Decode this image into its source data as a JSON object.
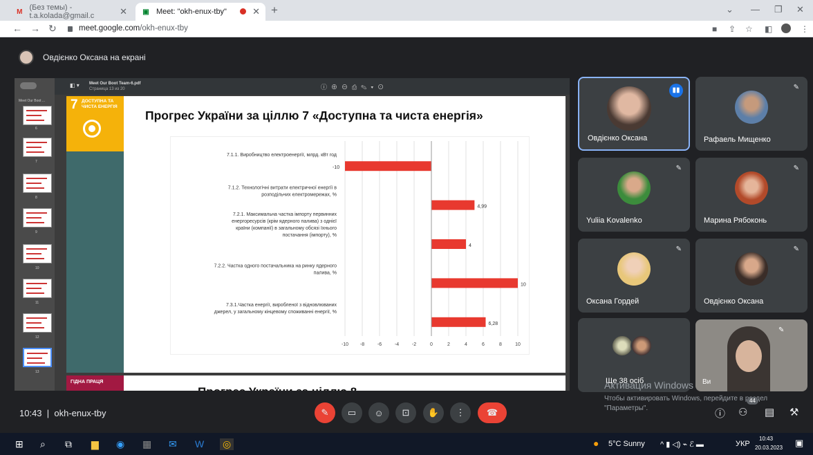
{
  "browser": {
    "tab1_title": "(Без темы) - t.a.kolada@gmail.c",
    "tab2_title": "Meet: \"okh-enux-tby\"",
    "url_host": "meet.google.com",
    "url_path": "/okh-enux-tby"
  },
  "meet": {
    "presenter_label": "Овдієнко Оксана на екрані",
    "meeting_time": "10:43",
    "meeting_code": "okh-enux-tby",
    "participants_count": "44"
  },
  "pdf": {
    "file_name": "Meet Our Boot Team-6.pdf",
    "page_label": "Страница 13 из 20",
    "thumb_header": "Meet Our Boot ...",
    "thumb_pages": [
      "6",
      "7",
      "8",
      "9",
      "10",
      "11",
      "12",
      "13"
    ]
  },
  "slide": {
    "sdg_number": "7",
    "sdg_label": "ДОСТУПНА ТА ЧИСТА ЕНЕРГІЯ",
    "title": "Прогрес України за ціллю 7 «Доступна та чиста енергія»",
    "next_sdg_label": "ГІДНА ПРАЦЯ",
    "next_title": "Прогрес України за ціллю 8"
  },
  "chart_data": {
    "type": "bar",
    "orientation": "horizontal",
    "categories": [
      "7.1.1. Виробництво електроенергії, млрд. кВт год",
      "7.1.2. Технологічні витрати електричної енергії в розподільчих електромережах, %",
      "7.2.1. Максимальна частка імпорту первинних енергоресурсів (крім ядерного палива) з однієї країни (компанії) в загальному обсязі їхнього постачання (імпорту), %",
      "7.2.2. Частка одного постачальника на ринку ядерного палива, %",
      "7.3.1.Частка енергії, виробленої з відновлюваних джерел, у загальному кінцевому споживанні енергії, %"
    ],
    "values": [
      -10,
      4.99,
      4,
      10,
      6.28
    ],
    "data_labels": [
      "-10",
      "4,99",
      "4",
      "10",
      "6,28"
    ],
    "xlim": [
      -10,
      10
    ],
    "x_ticks": [
      "-10",
      "-8",
      "-6",
      "-4",
      "-2",
      "0",
      "2",
      "4",
      "6",
      "8",
      "10"
    ],
    "bar_color": "#e8392f",
    "grid": true
  },
  "participants": [
    {
      "name": "Овдієнко Оксана",
      "speaking": true
    },
    {
      "name": "Рафаель Мищенко"
    },
    {
      "name": "Yuliia Kovalenko"
    },
    {
      "name": "Марина Рябоконь"
    },
    {
      "name": "Оксана Гордей"
    },
    {
      "name": "Овдієнко Оксана"
    },
    {
      "name": "Ще 38 осіб"
    },
    {
      "name": "Ви"
    }
  ],
  "windows": {
    "activation_title": "Активация Windows",
    "activation_text": "Чтобы активировать Windows, перейдите в раздел \"Параметры\".",
    "weather": "5°C  Sunny",
    "lang": "УКР",
    "clock_time": "10:43",
    "clock_date": "20.03.2023"
  },
  "colors": {
    "accent": "#8ab4f8",
    "end_call": "#ea4335",
    "sdg7": "#f5b20a",
    "sdg8": "#a21942"
  }
}
